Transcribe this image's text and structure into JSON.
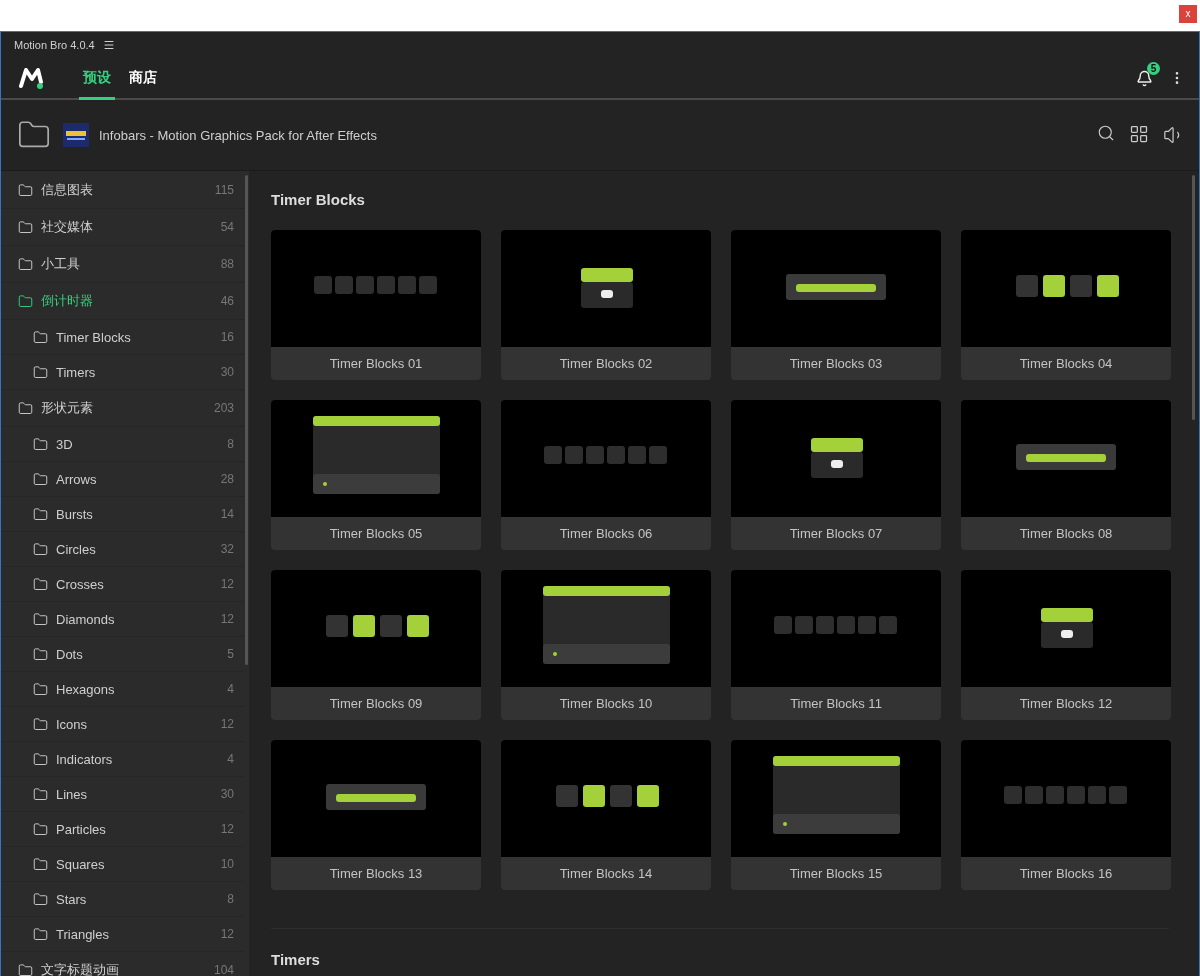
{
  "host_window": {
    "close": "x"
  },
  "window": {
    "title": "Motion Bro 4.0.4"
  },
  "nav": {
    "tabs": [
      {
        "label": "预设",
        "selected": true
      },
      {
        "label": "商店",
        "selected": false
      }
    ],
    "notifications": {
      "count": "5"
    }
  },
  "pack": {
    "title": "Infobars - Motion Graphics Pack for After Effects"
  },
  "sidebar": {
    "items": [
      {
        "label": "信息图表",
        "count": "115",
        "selected": false
      },
      {
        "label": "社交媒体",
        "count": "54",
        "selected": false
      },
      {
        "label": "小工具",
        "count": "88",
        "selected": false
      },
      {
        "label": "倒计时器",
        "count": "46",
        "selected": true,
        "children": [
          {
            "label": "Timer Blocks",
            "count": "16",
            "selected": false
          },
          {
            "label": "Timers",
            "count": "30",
            "selected": false
          }
        ]
      },
      {
        "label": "形状元素",
        "count": "203",
        "selected": false,
        "children": [
          {
            "label": "3D",
            "count": "8",
            "selected": false
          },
          {
            "label": "Arrows",
            "count": "28",
            "selected": false
          },
          {
            "label": "Bursts",
            "count": "14",
            "selected": false
          },
          {
            "label": "Circles",
            "count": "32",
            "selected": false
          },
          {
            "label": "Crosses",
            "count": "12",
            "selected": false
          },
          {
            "label": "Diamonds",
            "count": "12",
            "selected": false
          },
          {
            "label": "Dots",
            "count": "5",
            "selected": false
          },
          {
            "label": "Hexagons",
            "count": "4",
            "selected": false
          },
          {
            "label": "Icons",
            "count": "12",
            "selected": false
          },
          {
            "label": "Indicators",
            "count": "4",
            "selected": false
          },
          {
            "label": "Lines",
            "count": "30",
            "selected": false
          },
          {
            "label": "Particles",
            "count": "12",
            "selected": false
          },
          {
            "label": "Squares",
            "count": "10",
            "selected": false
          },
          {
            "label": "Stars",
            "count": "8",
            "selected": false
          },
          {
            "label": "Triangles",
            "count": "12",
            "selected": false
          }
        ]
      },
      {
        "label": "文字标题动画",
        "count": "104",
        "selected": false
      }
    ]
  },
  "sections": [
    {
      "title": "Timer Blocks",
      "cards": [
        {
          "label": "Timer Blocks 01",
          "kind": "picture"
        },
        {
          "label": "Timer Blocks 02",
          "kind": "picture"
        },
        {
          "label": "Timer Blocks 03",
          "kind": "picture"
        },
        {
          "label": "Timer Blocks 04",
          "kind": "picture"
        },
        {
          "label": "Timer Blocks 05",
          "kind": "picture"
        },
        {
          "label": "Timer Blocks 06",
          "kind": "picture"
        },
        {
          "label": "Timer Blocks 07",
          "kind": "picture"
        },
        {
          "label": "Timer Blocks 08",
          "kind": "picture"
        },
        {
          "label": "Timer Blocks 09",
          "kind": "picture"
        },
        {
          "label": "Timer Blocks 10",
          "kind": "picture"
        },
        {
          "label": "Timer Blocks 11",
          "kind": "picture"
        },
        {
          "label": "Timer Blocks 12",
          "kind": "picture"
        },
        {
          "label": "Timer Blocks 13",
          "kind": "picture"
        },
        {
          "label": "Timer Blocks 14",
          "kind": "picture"
        },
        {
          "label": "Timer Blocks 15",
          "kind": "picture"
        },
        {
          "label": "Timer Blocks 16",
          "kind": "picture"
        }
      ]
    },
    {
      "title": "Timers"
    }
  ]
}
